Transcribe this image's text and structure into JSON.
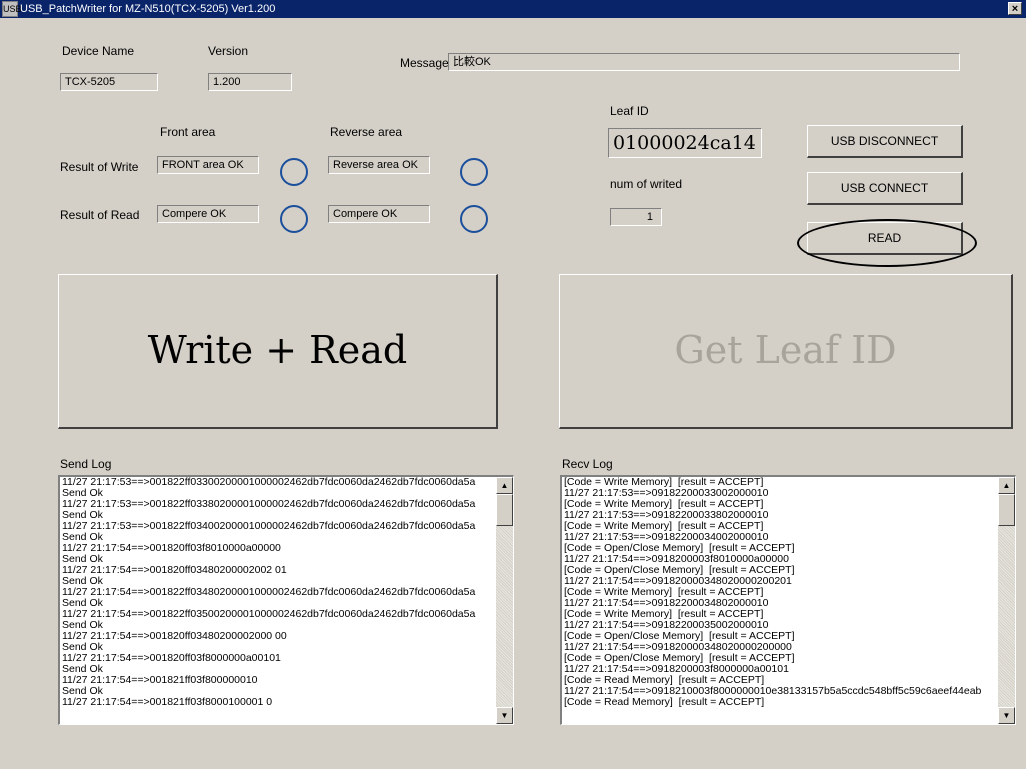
{
  "window": {
    "title": "USB_PatchWriter for MZ-N510(TCX-5205) Ver1.200",
    "icon_label": "USB",
    "close_label": "×"
  },
  "device": {
    "name_label": "Device Name",
    "name_value": "TCX-5205",
    "version_label": "Version",
    "version_value": "1.200"
  },
  "message": {
    "label": "Message",
    "value": "比較OK"
  },
  "areas": {
    "front_label": "Front area",
    "reverse_label": "Reverse area",
    "write_label": "Result of Write",
    "read_label": "Result of Read",
    "write_front": "FRONT area OK",
    "write_reverse": "Reverse area OK",
    "read_front": "Compere OK",
    "read_reverse": "Compere OK"
  },
  "leaf": {
    "label": "Leaf ID",
    "value": "01000024ca14",
    "num_label": "num of writed",
    "num_value": "1"
  },
  "buttons": {
    "usb_disconnect": "USB DISCONNECT",
    "usb_connect": "USB CONNECT",
    "read": "READ",
    "write_read": "Write + Read",
    "get_leaf_id": "Get Leaf ID"
  },
  "colors": {
    "get_leaf_disabled_text": "#a8a49c",
    "status_circle": "#1b4f9c"
  },
  "send_log": {
    "label": "Send Log",
    "lines": [
      "11/27 21:17:53==>001822ff03300200001000002462db7fdc0060da2462db7fdc0060da5a",
      "Send Ok",
      "11/27 21:17:53==>001822ff03380200001000002462db7fdc0060da2462db7fdc0060da5a",
      "Send Ok",
      "11/27 21:17:53==>001822ff03400200001000002462db7fdc0060da2462db7fdc0060da5a",
      "Send Ok",
      "11/27 21:17:54==>001820ff03f8010000a00000",
      "Send Ok",
      "11/27 21:17:54==>001820ff03480200002002 01",
      "Send Ok",
      "11/27 21:17:54==>001822ff03480200001000002462db7fdc0060da2462db7fdc0060da5a",
      "Send Ok",
      "11/27 21:17:54==>001822ff03500200001000002462db7fdc0060da2462db7fdc0060da5a",
      "Send Ok",
      "11/27 21:17:54==>001820ff03480200002000 00",
      "Send Ok",
      "11/27 21:17:54==>001820ff03f8000000a00101",
      "Send Ok",
      "11/27 21:17:54==>001821ff03f800000010",
      "Send Ok",
      "11/27 21:17:54==>001821ff03f8000100001 0"
    ]
  },
  "recv_log": {
    "label": "Recv Log",
    "lines": [
      "[Code = Write Memory]  [result = ACCEPT]",
      "11/27 21:17:53==>09182200033002000010",
      "[Code = Write Memory]  [result = ACCEPT]",
      "11/27 21:17:53==>09182200033802000010",
      "[Code = Write Memory]  [result = ACCEPT]",
      "11/27 21:17:53==>09182200034002000010",
      "[Code = Open/Close Memory]  [result = ACCEPT]",
      "11/27 21:17:54==>0918200003f8010000a00000",
      "[Code = Open/Close Memory]  [result = ACCEPT]",
      "11/27 21:17:54==>091820000348020000200201",
      "[Code = Write Memory]  [result = ACCEPT]",
      "11/27 21:17:54==>09182200034802000010",
      "[Code = Write Memory]  [result = ACCEPT]",
      "11/27 21:17:54==>09182200035002000010",
      "[Code = Open/Close Memory]  [result = ACCEPT]",
      "11/27 21:17:54==>091820000348020000200000",
      "[Code = Open/Close Memory]  [result = ACCEPT]",
      "11/27 21:17:54==>0918200003f8000000a00101",
      "[Code = Read Memory]  [result = ACCEPT]",
      "11/27 21:17:54==>0918210003f8000000010e38133157b5a5ccdc548bff5c59c6aeef44eab",
      "[Code = Read Memory]  [result = ACCEPT]"
    ]
  }
}
